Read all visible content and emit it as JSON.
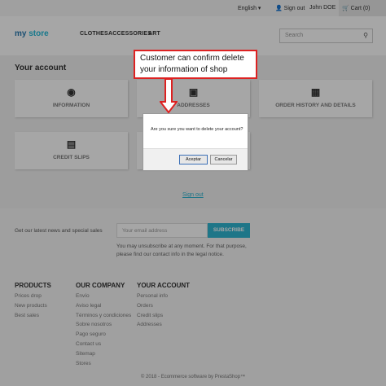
{
  "topbar": {
    "language": "English ▾",
    "signout": "Sign out",
    "user": "John DOE",
    "cart": "Cart (0)"
  },
  "header": {
    "logo_a": "my",
    "logo_b": "store",
    "nav": [
      "CLOTHES",
      "ACCESSORIES",
      "ART"
    ],
    "search_placeholder": "Search"
  },
  "account": {
    "title": "Your account",
    "cards": [
      {
        "label": "INFORMATION",
        "icon": "person-icon"
      },
      {
        "label": "ADDRESSES",
        "icon": "address-icon"
      },
      {
        "label": "ORDER HISTORY AND DETAILS",
        "icon": "calendar-icon"
      },
      {
        "label": "CREDIT SLIPS",
        "icon": "document-icon"
      },
      {
        "label": "",
        "icon": ""
      }
    ],
    "signout_link": "Sign out"
  },
  "newsletter": {
    "label": "Get our latest news and special sales",
    "placeholder": "Your email address",
    "button": "SUBSCRIBE",
    "note_line1": "You may unsubscribe at any moment. For that purpose,",
    "note_line2": "please find our contact info in the legal notice."
  },
  "footer": {
    "products": {
      "title": "PRODUCTS",
      "items": [
        "Prices drop",
        "New products",
        "Best sales"
      ]
    },
    "company": {
      "title": "OUR COMPANY",
      "items": [
        "Envío",
        "Aviso legal",
        "Términos y condiciones",
        "Sobre nosotros",
        "Pago seguro",
        "Contact us",
        "Sitemap",
        "Stores"
      ]
    },
    "account": {
      "title": "YOUR ACCOUNT",
      "items": [
        "Personal info",
        "Orders",
        "Credit slips",
        "Addresses"
      ]
    },
    "copyright": "© 2018 - Ecommerce software by PrestaShop™"
  },
  "dialog": {
    "message": "Are you sure you want to delete your account?",
    "ok": "Aceptar",
    "cancel": "Cancelar"
  },
  "annotation": {
    "line1": "Customer can confirm delete",
    "line2": "your information of shop",
    "color": "#dd2222"
  }
}
